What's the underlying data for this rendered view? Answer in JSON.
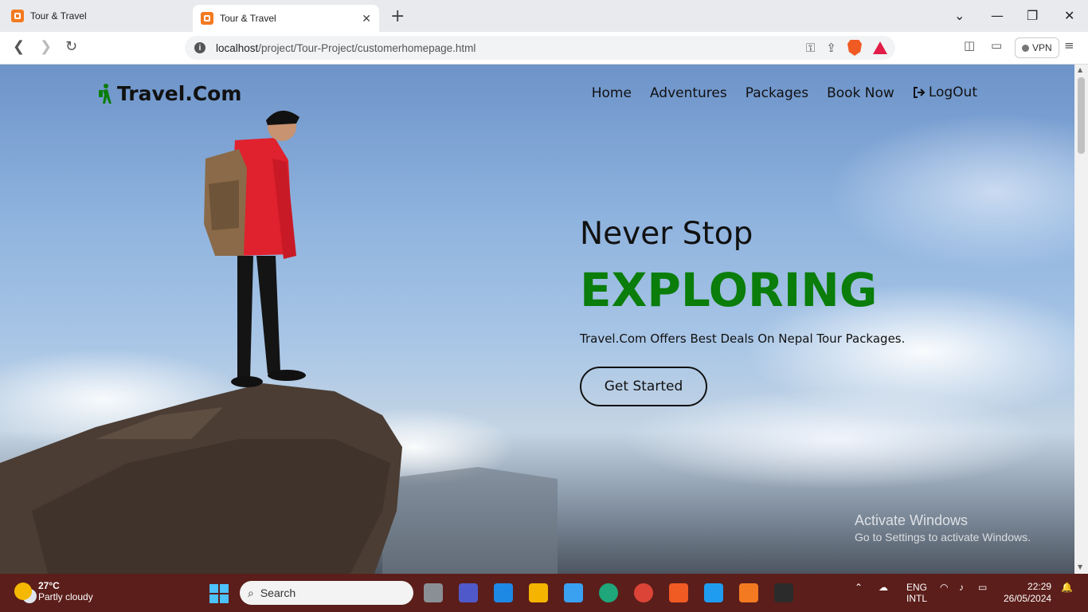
{
  "browser": {
    "tabs": [
      {
        "label": "Tour & Travel",
        "active": false
      },
      {
        "label": "Tour & Travel",
        "active": true
      }
    ],
    "url_host": "localhost",
    "url_path": "/project/Tour-Project/customerhomepage.html",
    "vpn_label": "VPN"
  },
  "site": {
    "logo": "Travel.Com",
    "nav": [
      "Home",
      "Adventures",
      "Packages",
      "Book Now",
      "LogOut"
    ],
    "hero": {
      "line1": "Never Stop",
      "line2": "EXPLORING",
      "tagline": "Travel.Com Offers Best Deals On Nepal Tour Packages.",
      "cta": "Get Started"
    },
    "accent_color": "#0a7d0a"
  },
  "watermark": {
    "title": "Activate Windows",
    "subtitle": "Go to Settings to activate Windows."
  },
  "taskbar": {
    "weather_temp": "27°C",
    "weather_desc": "Partly cloudy",
    "search_placeholder": "Search",
    "lang_top": "ENG",
    "lang_bottom": "INTL",
    "time": "22:29",
    "date": "26/05/2024"
  }
}
